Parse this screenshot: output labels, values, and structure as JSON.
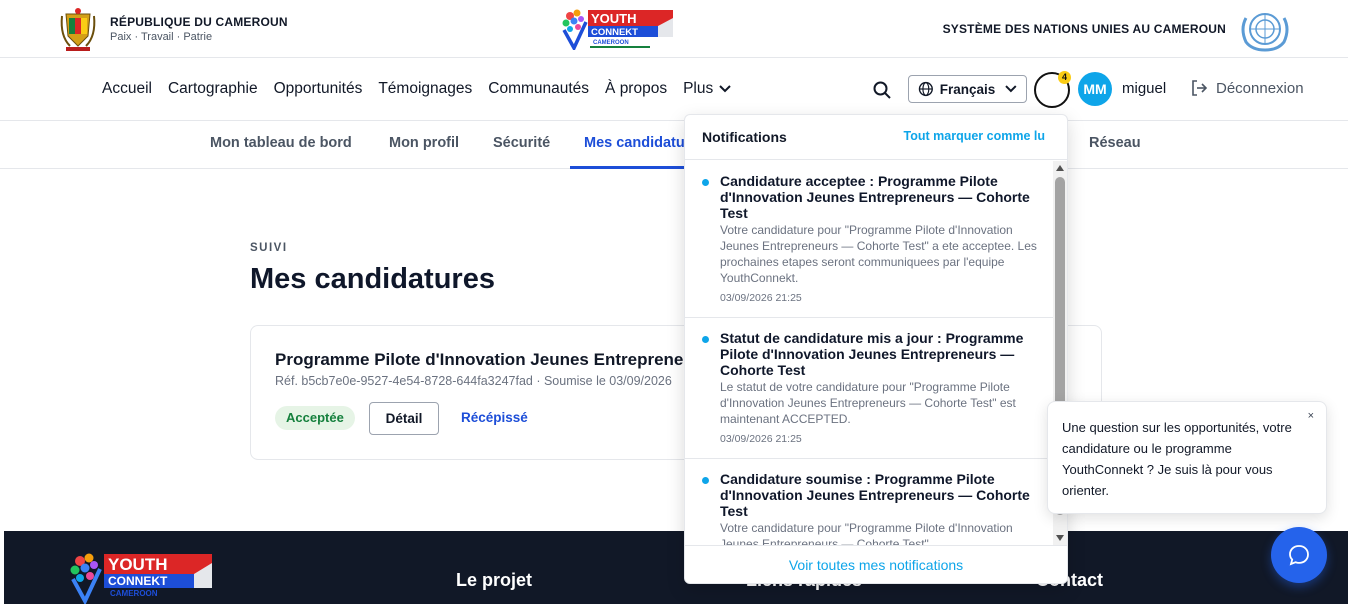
{
  "gov": {
    "title": "RÉPUBLIQUE DU CAMEROUN",
    "motto": "Paix · Travail · Patrie",
    "un_title": "SYSTÈME DES NATIONS UNIES AU CAMEROUN",
    "logo_text": {
      "line1": "YOUTH",
      "line2": "CONNEKT",
      "line3": "CAMEROON"
    }
  },
  "nav": {
    "items": [
      "Accueil",
      "Cartographie",
      "Opportunités",
      "Témoignages",
      "Communautés",
      "À propos"
    ],
    "more_label": "Plus",
    "language": "Français",
    "notification_count": "4",
    "avatar_initials": "MM",
    "username": "miguel",
    "logout_label": "Déconnexion"
  },
  "subnav": {
    "items": [
      "Mon tableau de bord",
      "Mon profil",
      "Sécurité",
      "Mes candidatures",
      "Réseau"
    ],
    "active_index": 3
  },
  "main": {
    "section_label": "SUIVI",
    "title": "Mes candidatures",
    "application": {
      "title": "Programme Pilote d'Innovation Jeunes Entrepreneurs — Cohorte Test",
      "ref": "Réf. b5cb7e0e-9527-4e54-8728-644fa3247fad · Soumise le 03/09/2026",
      "status": "Acceptée",
      "detail_label": "Détail",
      "receipt_label": "Récépissé"
    }
  },
  "notifications": {
    "title": "Notifications",
    "mark_all": "Tout marquer comme lu",
    "view_all": "Voir toutes mes notifications",
    "items": [
      {
        "title": "Candidature acceptee : Programme Pilote d'Innovation Jeunes Entrepreneurs — Cohorte Test",
        "body": "Votre candidature pour \"Programme Pilote d'Innovation Jeunes Entrepreneurs — Cohorte Test\" a ete acceptee. Les prochaines etapes seront communiquees par l'equipe YouthConnekt.",
        "time": "03/09/2026 21:25"
      },
      {
        "title": "Statut de candidature mis a jour : Programme Pilote d'Innovation Jeunes Entrepreneurs — Cohorte Test",
        "body": "Le statut de votre candidature pour \"Programme Pilote d'Innovation Jeunes Entrepreneurs — Cohorte Test\" est maintenant ACCEPTED.",
        "time": "03/09/2026 21:25"
      },
      {
        "title": "Candidature soumise : Programme Pilote d'Innovation Jeunes Entrepreneurs — Cohorte Test",
        "body": "Votre candidature pour \"Programme Pilote d'Innovation Jeunes Entrepreneurs — Cohorte Test\"",
        "time": ""
      }
    ]
  },
  "chat": {
    "message": "Une question sur les opportunités, votre candidature ou le programme YouthConnekt ? Je suis là pour vous orienter.",
    "close": "×"
  },
  "footer": {
    "headings": [
      "Le projet",
      "Liens rapides",
      "Contact"
    ]
  },
  "colors": {
    "accent": "#1d4ed8",
    "link": "#0ea5e9",
    "footer_bg": "#111827",
    "success_bg": "#e6f4e6",
    "success_text": "#15803d",
    "badge": "#facc15"
  }
}
